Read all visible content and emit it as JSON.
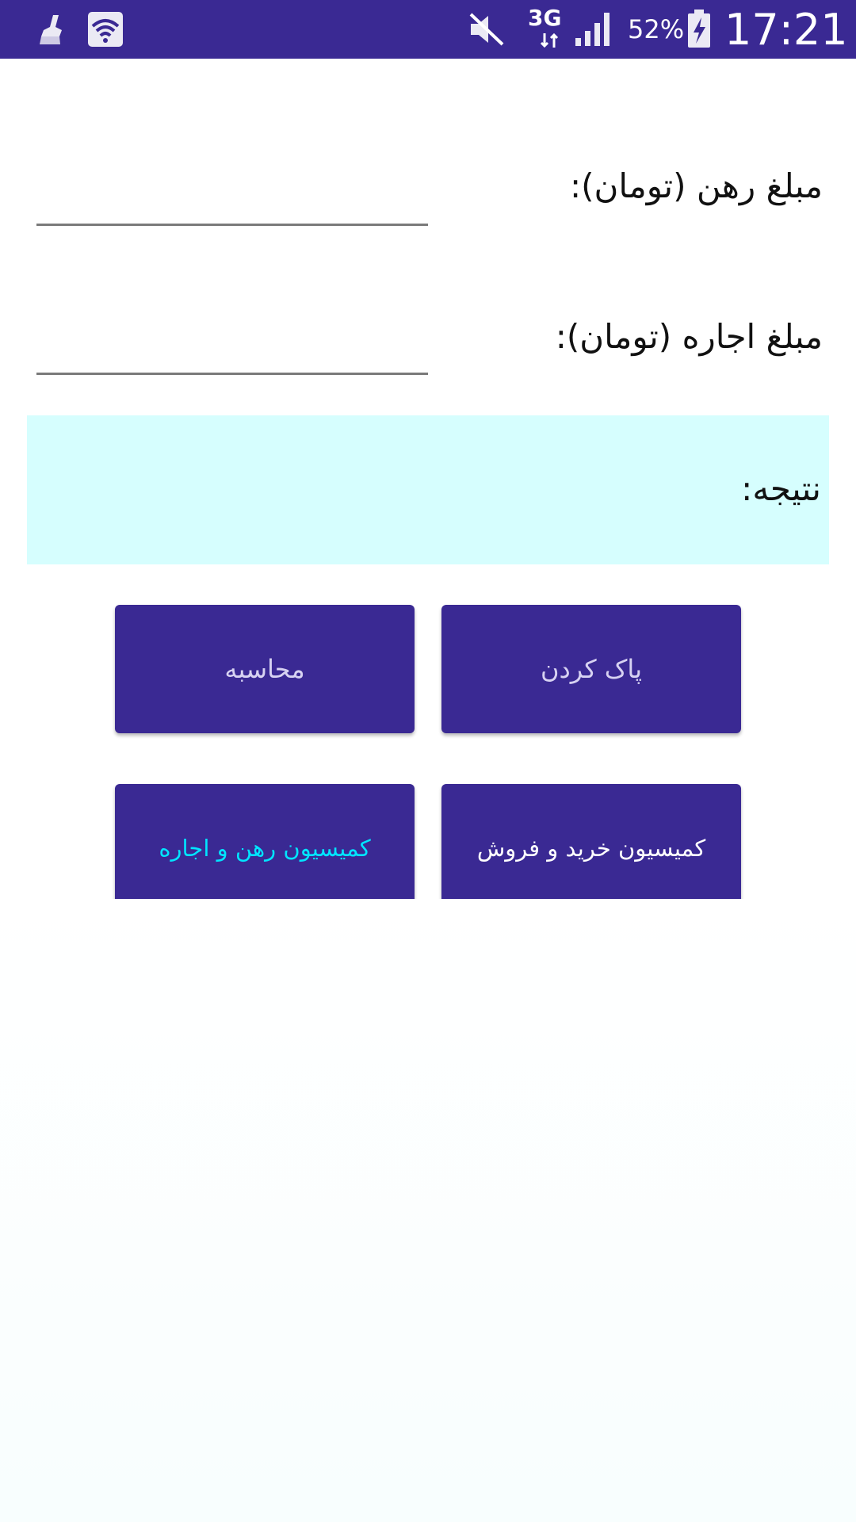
{
  "status_bar": {
    "battery_percent": "52%",
    "network": "3G",
    "time": "17:21",
    "icons": [
      "cleaner-icon",
      "wifi-icon",
      "mute-icon",
      "signal-icon",
      "battery-icon"
    ]
  },
  "form": {
    "deposit_label": "مبلغ رهن (تومان):",
    "deposit_value": "",
    "rent_label": "مبلغ اجاره (تومان):",
    "rent_value": ""
  },
  "result": {
    "label": "نتیجه:"
  },
  "buttons": {
    "calculate": "محاسبه",
    "clear": "پاک کردن",
    "rent_commission": "کمیسیون رهن و اجاره",
    "sale_commission": "کمیسیون خرید و فروش"
  },
  "colors": {
    "primary": "#3a2993",
    "result_bg": "#d6fefe",
    "button_text": "#d7d2f2",
    "active_tab_text": "#00e5ff",
    "sale_button_text": "#ffffff"
  }
}
